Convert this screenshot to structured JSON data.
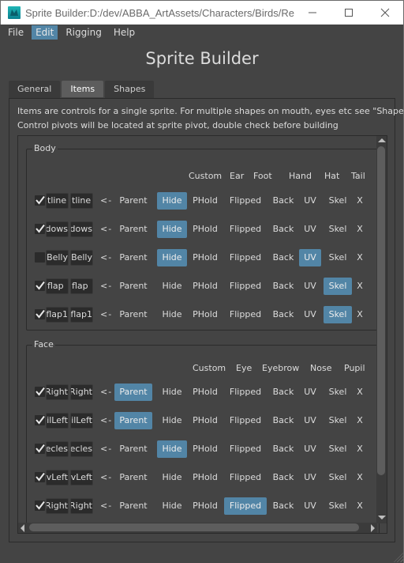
{
  "window": {
    "title": "Sprite Builder:D:/dev/ABBA_ArtAssets/Characters/Birds/RedBir...",
    "icon": "maya-app-icon",
    "controls": [
      "minimize",
      "maximize",
      "close"
    ]
  },
  "menubar": {
    "items": [
      {
        "label": "File",
        "active": false
      },
      {
        "label": "Edit",
        "active": true
      },
      {
        "label": "Rigging",
        "active": false
      },
      {
        "label": "Help",
        "active": false
      }
    ]
  },
  "header": {
    "title": "Sprite Builder"
  },
  "tabs": [
    {
      "label": "General",
      "active": false
    },
    {
      "label": "Items",
      "active": true
    },
    {
      "label": "Shapes",
      "active": false
    }
  ],
  "items_tab": {
    "info_line1": "Items are controls for a single sprite. For multiple shapes on mouth, eyes etc see \"Shapes\"",
    "info_line2": "Control pivots will be located at sprite pivot, double check before building",
    "accent_color": "#5285a6",
    "button_labels": {
      "arrow": "<-",
      "parent": "Parent",
      "hide": "Hide",
      "phold": "PHold",
      "flipped": "Flipped",
      "back": "Back",
      "uv": "UV",
      "skel": "Skel",
      "x": "X"
    },
    "groups": [
      {
        "title": "Body",
        "headers": [
          "Custom",
          "Ear",
          "Foot",
          "Hand",
          "Hat",
          "Tail"
        ],
        "rows": [
          {
            "checked": true,
            "field1": "tline",
            "field2": "tline",
            "parent": false,
            "hide": true,
            "phold": false,
            "flipped": false,
            "back": false,
            "uv": false,
            "skel": false
          },
          {
            "checked": true,
            "field1": "dows",
            "field2": "dows",
            "parent": false,
            "hide": true,
            "phold": false,
            "flipped": false,
            "back": false,
            "uv": false,
            "skel": false
          },
          {
            "checked": false,
            "field1": "Belly",
            "field2": "Belly",
            "parent": false,
            "hide": true,
            "phold": false,
            "flipped": false,
            "back": false,
            "uv": true,
            "skel": false
          },
          {
            "checked": true,
            "field1": "flap",
            "field2": "flap",
            "parent": false,
            "hide": false,
            "phold": false,
            "flipped": false,
            "back": false,
            "uv": false,
            "skel": true
          },
          {
            "checked": true,
            "field1": "flap1",
            "field2": "flap1",
            "parent": false,
            "hide": false,
            "phold": false,
            "flipped": false,
            "back": false,
            "uv": false,
            "skel": true
          }
        ]
      },
      {
        "title": "Face",
        "headers": [
          "Custom",
          "Eye",
          "Eyebrow",
          "Nose",
          "Pupil"
        ],
        "rows": [
          {
            "checked": true,
            "field1": "Right",
            "field2": "Right",
            "parent": true,
            "hide": false,
            "phold": false,
            "flipped": false,
            "back": false,
            "uv": false,
            "skel": false
          },
          {
            "checked": true,
            "field1": "ilLeft",
            "field2": "ilLeft",
            "parent": true,
            "hide": false,
            "phold": false,
            "flipped": false,
            "back": false,
            "uv": false,
            "skel": false
          },
          {
            "checked": true,
            "field1": "ecles",
            "field2": "ecles",
            "parent": false,
            "hide": true,
            "phold": false,
            "flipped": false,
            "back": false,
            "uv": false,
            "skel": false
          },
          {
            "checked": true,
            "field1": "vLeft",
            "field2": "vLeft",
            "parent": false,
            "hide": false,
            "phold": false,
            "flipped": false,
            "back": false,
            "uv": false,
            "skel": false
          },
          {
            "checked": true,
            "field1": "Right",
            "field2": "Right",
            "parent": false,
            "hide": false,
            "phold": false,
            "flipped": true,
            "back": false,
            "uv": false,
            "skel": false
          }
        ]
      }
    ]
  }
}
